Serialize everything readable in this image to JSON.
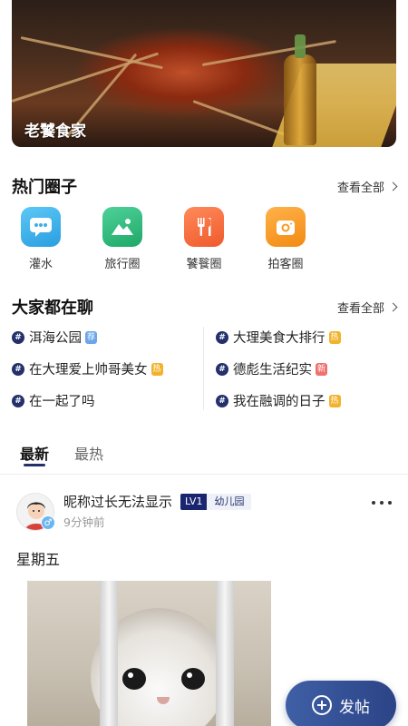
{
  "banner": {
    "title": "老饕食家"
  },
  "hot_circles": {
    "title": "热门圈子",
    "see_all": "查看全部",
    "items": [
      {
        "label": "灌水",
        "icon": "chat-bubble-icon",
        "color": "#3aaee8"
      },
      {
        "label": "旅行圈",
        "icon": "landscape-icon",
        "color": "#2fb67a"
      },
      {
        "label": "饕餮圈",
        "icon": "fork-knife-icon",
        "color": "#f26a3b"
      },
      {
        "label": "拍客圈",
        "icon": "camera-icon",
        "color": "#f59a23"
      }
    ]
  },
  "trending": {
    "title": "大家都在聊",
    "see_all": "查看全部",
    "topics": [
      {
        "text": "洱海公园",
        "tag": "荐",
        "tag_color": "#6aa6e8"
      },
      {
        "text": "大理美食大排行",
        "tag": "热",
        "tag_color": "#f2b22b"
      },
      {
        "text": "在大理爱上帅哥美女",
        "tag": "热",
        "tag_color": "#f2b22b"
      },
      {
        "text": "德彪生活纪实",
        "tag": "新",
        "tag_color": "#f07070"
      },
      {
        "text": "在一起了吗",
        "tag": "",
        "tag_color": ""
      },
      {
        "text": "我在融调的日子",
        "tag": "热",
        "tag_color": "#f2b22b"
      }
    ]
  },
  "tabs": {
    "latest": "最新",
    "hottest": "最热"
  },
  "post": {
    "nickname": "昵称过长无法显示",
    "level": "LV1",
    "level_title": "幼儿园",
    "time": "9分钟前",
    "text": "星期五",
    "gender": "♂"
  },
  "fab": {
    "label": "发帖"
  },
  "colors": {
    "accent": "#23306b",
    "fab": "#3a559b"
  }
}
